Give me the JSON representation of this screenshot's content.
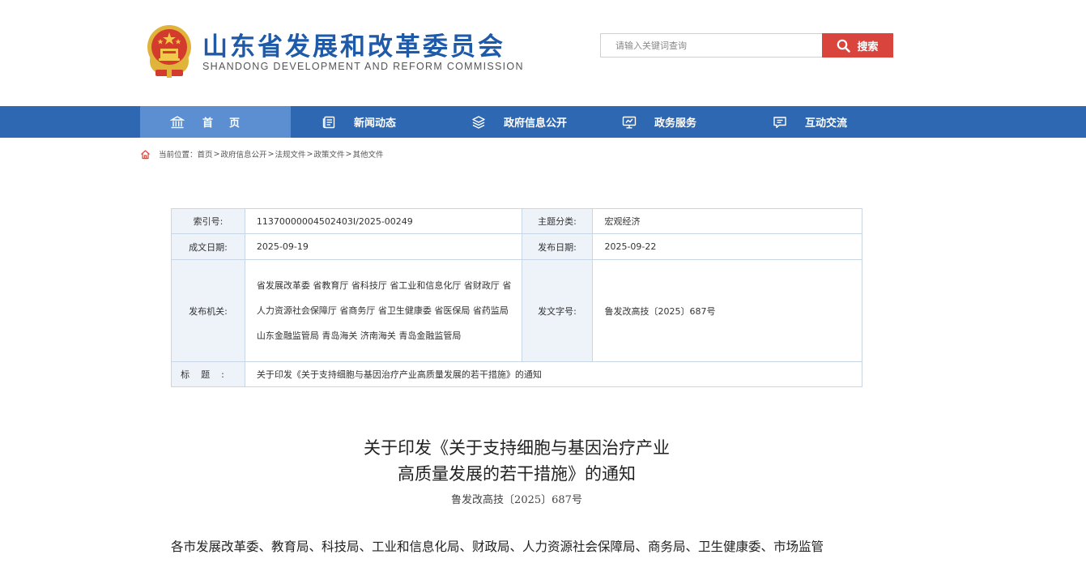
{
  "header": {
    "site_title": "山东省发展和改革委员会",
    "site_subtitle": "SHANDONG DEVELOPMENT AND REFORM COMMISSION",
    "search_placeholder": "请输入关键词查询",
    "search_label": "搜索"
  },
  "nav": {
    "items": [
      {
        "label": "首页",
        "icon": "bank-icon"
      },
      {
        "label": "新闻动态",
        "icon": "newspaper-icon"
      },
      {
        "label": "政府信息公开",
        "icon": "layers-icon"
      },
      {
        "label": "政务服务",
        "icon": "monitor-icon"
      },
      {
        "label": "互动交流",
        "icon": "chat-icon"
      }
    ]
  },
  "breadcrumb": {
    "prefix": "当前位置：",
    "items": [
      "首页",
      "政府信息公开",
      "法规文件",
      "政策文件",
      "其他文件"
    ],
    "separator": ">"
  },
  "info": {
    "index_label": "索引号:",
    "index_value": "11370000004502403I/2025-00249",
    "topic_label": "主题分类:",
    "topic_value": "宏观经济",
    "written_label": "成文日期:",
    "written_value": "2025-09-19",
    "published_label": "发布日期:",
    "published_value": "2025-09-22",
    "issuer_label": "发布机关:",
    "issuer_value": "省发展改革委 省教育厅 省科技厅 省工业和信息化厅 省财政厅 省人力资源社会保障厅 省商务厅 省卫生健康委 省医保局 省药监局 山东金融监管局 青岛海关 济南海关 青岛金融监管局",
    "doc_no_label": "发文字号:",
    "doc_no_value": "鲁发改高技〔2025〕687号",
    "title_label": "标题:",
    "title_value": "关于印发《关于支持细胞与基因治疗产业高质量发展的若干措施》的通知"
  },
  "document": {
    "title_line1": "关于印发《关于支持细胞与基因治疗产业",
    "title_line2": "高质量发展的若干措施》的通知",
    "number": "鲁发改高技〔2025〕687号",
    "body_first_line": "各市发展改革委、教育局、科技局、工业和信息化局、财政局、人力资源社会保障局、商务局、卫生健康委、市场监管"
  },
  "colors": {
    "brand_blue": "#2e68b3",
    "nav_active": "#5b8fd1",
    "search_red": "#d9453d",
    "title_blue": "#1f5aa8"
  }
}
